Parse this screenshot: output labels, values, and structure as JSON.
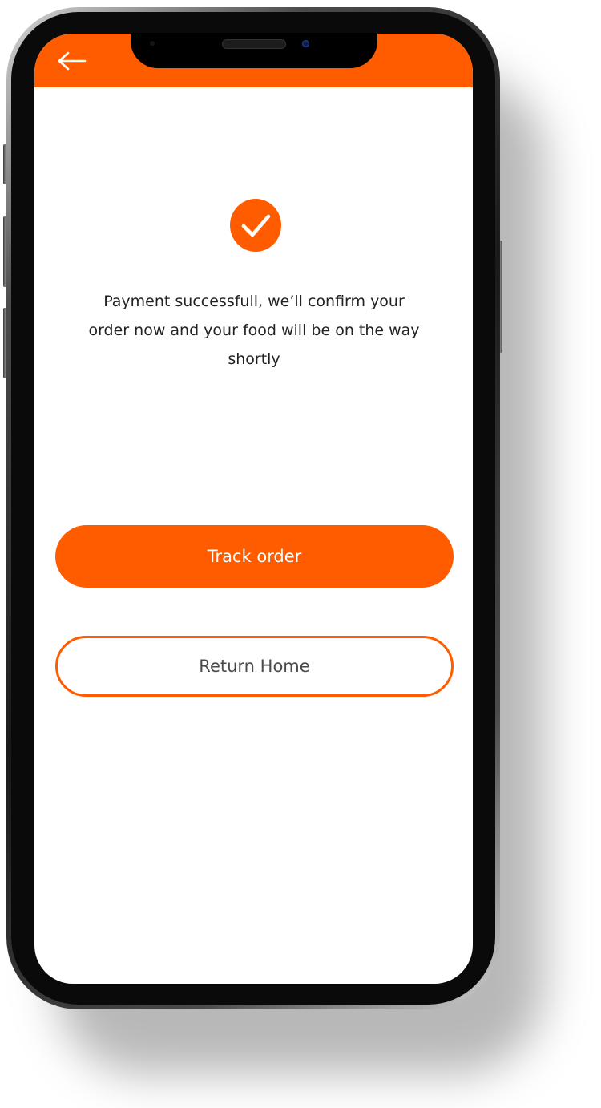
{
  "header": {
    "back_icon": "arrow-left-icon",
    "background_color": "#FF5C00"
  },
  "status": {
    "icon": "checkmark-icon",
    "message": "Payment successfull, we’ll confirm your order now and your food will be on the way shortly"
  },
  "actions": {
    "track_order_label": "Track order",
    "return_home_label": "Return Home"
  },
  "colors": {
    "accent": "#FF5C00",
    "text": "#222222",
    "secondary_text": "#4a4a4a"
  }
}
